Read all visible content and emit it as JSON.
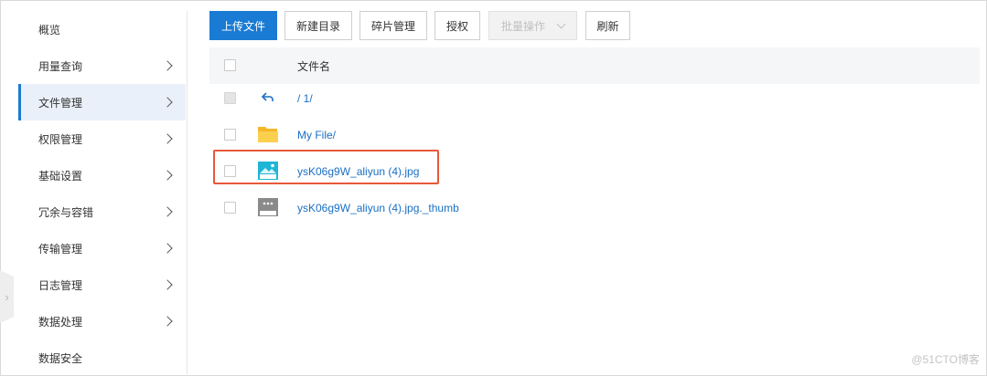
{
  "sidebar": {
    "items": [
      {
        "label": "概览",
        "has_chevron": false,
        "active": false
      },
      {
        "label": "用量查询",
        "has_chevron": true,
        "active": false
      },
      {
        "label": "文件管理",
        "has_chevron": true,
        "active": true
      },
      {
        "label": "权限管理",
        "has_chevron": true,
        "active": false
      },
      {
        "label": "基础设置",
        "has_chevron": true,
        "active": false
      },
      {
        "label": "冗余与容错",
        "has_chevron": true,
        "active": false
      },
      {
        "label": "传输管理",
        "has_chevron": true,
        "active": false
      },
      {
        "label": "日志管理",
        "has_chevron": true,
        "active": false
      },
      {
        "label": "数据处理",
        "has_chevron": true,
        "active": false
      },
      {
        "label": "数据安全",
        "has_chevron": false,
        "active": false
      }
    ]
  },
  "toolbar": {
    "upload": "上传文件",
    "new_dir": "新建目录",
    "fragments": "碎片管理",
    "authorize": "授权",
    "batch": "批量操作",
    "refresh": "刷新"
  },
  "table": {
    "header": "文件名",
    "back_path": "/ 1/",
    "rows": [
      {
        "name": "My File/",
        "icon": "folder-icon"
      },
      {
        "name": "ysK06g9W_aliyun (4).jpg",
        "icon": "image-file-icon"
      },
      {
        "name": "ysK06g9W_aliyun (4).jpg._thumb",
        "icon": "generic-file-icon"
      }
    ]
  },
  "colors": {
    "primary": "#1a7bd4",
    "link": "#1a6fc4",
    "highlight": "#e8583a",
    "folder": "#f5b728",
    "image_icon": "#1fb5d6"
  },
  "watermark": "@51CTO博客"
}
